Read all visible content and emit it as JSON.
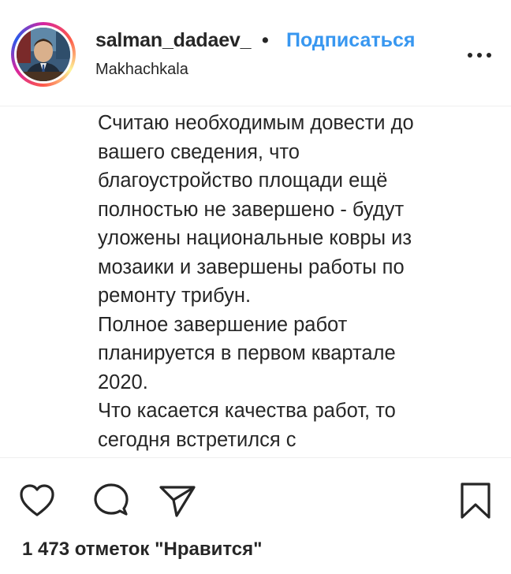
{
  "post_header": {
    "username": "salman_dadaev_",
    "separator": "•",
    "follow_label": "Подписаться",
    "location": "Makhachkala",
    "more_icon": "more-horizontal-icon"
  },
  "caption": {
    "text": "Считаю необходимым довести до\nвашего сведения, что\nблагоустройство площади ещё\nполностью не завершено - будут\nуложены национальные ковры из\nмозаики и завершены работы по\nремонту трибун.\nПолное завершение работ\nпланируется в первом квартале\n2020.\nЧто касается качества работ, то\nсегодня встретился с"
  },
  "actions": {
    "icons": [
      "heart-icon",
      "comment-icon",
      "share-icon",
      "bookmark-icon"
    ]
  },
  "likes": {
    "text": "1 473 отметок \"Нравится\""
  },
  "colors": {
    "accent": "#3897f0",
    "text": "#262626",
    "divider": "#efefef"
  }
}
